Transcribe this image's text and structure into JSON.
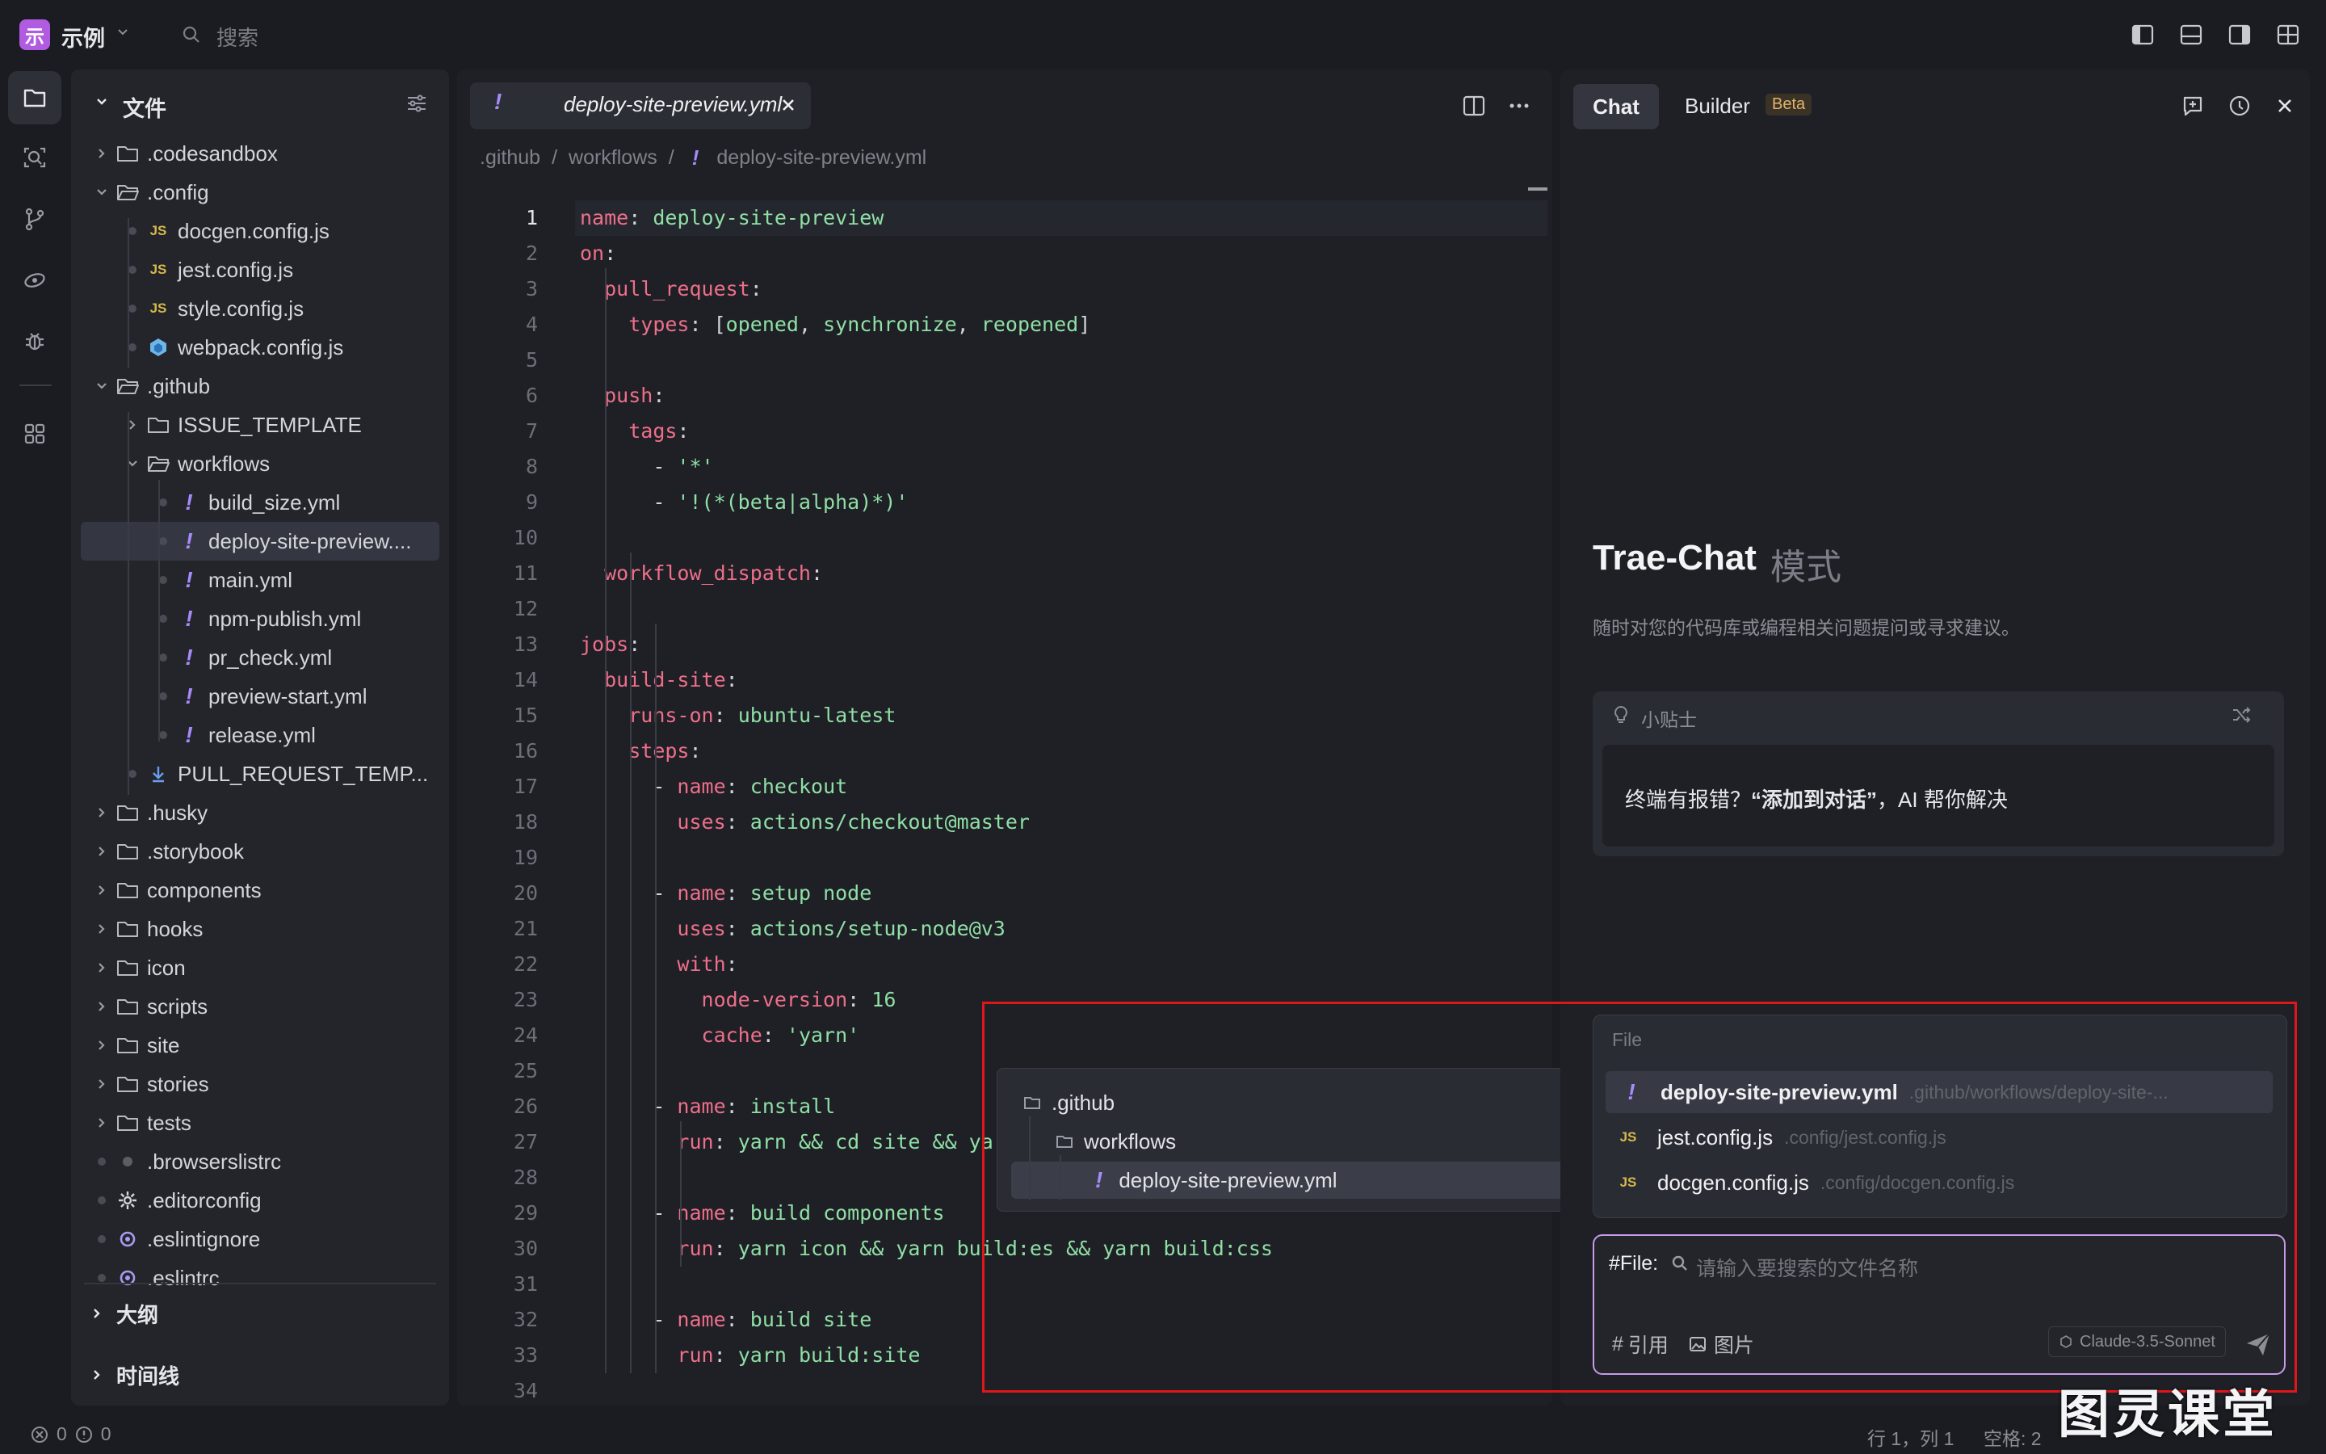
{
  "titlebar": {
    "logo_char": "示",
    "workspace": "示例",
    "search_placeholder": "搜索"
  },
  "explorer": {
    "title": "文件",
    "items": [
      {
        "label": ".codesandbox",
        "type": "folder",
        "expanded": false
      },
      {
        "label": ".config",
        "type": "folder",
        "expanded": true
      },
      {
        "label": "docgen.config.js",
        "type": "js"
      },
      {
        "label": "jest.config.js",
        "type": "js"
      },
      {
        "label": "style.config.js",
        "type": "js"
      },
      {
        "label": "webpack.config.js",
        "type": "webpack"
      },
      {
        "label": ".github",
        "type": "folder",
        "expanded": true
      },
      {
        "label": "ISSUE_TEMPLATE",
        "type": "folder",
        "expanded": false
      },
      {
        "label": "workflows",
        "type": "folder",
        "expanded": true
      },
      {
        "label": "build_size.yml",
        "type": "yml"
      },
      {
        "label": "deploy-site-preview....",
        "type": "yml",
        "selected": true
      },
      {
        "label": "main.yml",
        "type": "yml"
      },
      {
        "label": "npm-publish.yml",
        "type": "yml"
      },
      {
        "label": "pr_check.yml",
        "type": "yml"
      },
      {
        "label": "preview-start.yml",
        "type": "yml"
      },
      {
        "label": "release.yml",
        "type": "yml"
      },
      {
        "label": "PULL_REQUEST_TEMP...",
        "type": "md"
      },
      {
        "label": ".husky",
        "type": "folder",
        "expanded": false
      },
      {
        "label": ".storybook",
        "type": "folder",
        "expanded": false
      },
      {
        "label": "components",
        "type": "folder",
        "expanded": false
      },
      {
        "label": "hooks",
        "type": "folder",
        "expanded": false
      },
      {
        "label": "icon",
        "type": "folder",
        "expanded": false
      },
      {
        "label": "scripts",
        "type": "folder",
        "expanded": false
      },
      {
        "label": "site",
        "type": "folder",
        "expanded": false
      },
      {
        "label": "stories",
        "type": "folder",
        "expanded": false
      },
      {
        "label": "tests",
        "type": "folder",
        "expanded": false
      },
      {
        "label": ".browserslistrc",
        "type": "file"
      },
      {
        "label": ".editorconfig",
        "type": "gear"
      },
      {
        "label": ".eslintignore",
        "type": "circle"
      },
      {
        "label": ".eslintrc",
        "type": "circle"
      }
    ],
    "outline": "大纲",
    "timeline": "时间线"
  },
  "editor": {
    "tab_label": "deploy-site-preview.yml",
    "breadcrumb": [
      ".github",
      "workflows",
      "deploy-site-preview.yml"
    ],
    "lines": [
      "name: deploy-site-preview",
      "on:",
      "  pull_request:",
      "    types: [opened, synchronize, reopened]",
      "",
      "  push:",
      "    tags:",
      "      - '*'",
      "      - '!(*(beta|alpha)*)'",
      "",
      "  workflow_dispatch:",
      "",
      "jobs:",
      "  build-site:",
      "    runs-on: ubuntu-latest",
      "    steps:",
      "      - name: checkout",
      "        uses: actions/checkout@master",
      "",
      "      - name: setup node",
      "        uses: actions/setup-node@v3",
      "        with:",
      "          node-version: 16",
      "          cache: 'yarn'",
      "",
      "      - name: install",
      "        run: yarn && cd site && yarn",
      "",
      "      - name: build components",
      "        run: yarn icon && yarn build:es && yarn build:css",
      "",
      "      - name: build site",
      "        run: yarn build:site",
      ""
    ],
    "current_line": 1,
    "popup": [
      ".github",
      "workflows",
      "deploy-site-preview.yml"
    ]
  },
  "chat": {
    "tab_chat": "Chat",
    "tab_builder": "Builder",
    "beta": "Beta",
    "heading": "Trae-Chat",
    "heading_suffix": "模式",
    "description": "随时对您的代码库或编程相关问题提问或寻求建议。",
    "tips_title": "小贴士",
    "tips_text_1": "终端有报错？",
    "tips_text_bold": "“添加到对话”",
    "tips_text_2": "，AI 帮你解决",
    "file_header": "File",
    "files": [
      {
        "name": "deploy-site-preview.yml",
        "path": ".github/workflows/deploy-site-...",
        "type": "yml",
        "selected": true
      },
      {
        "name": "jest.config.js",
        "path": ".config/jest.config.js",
        "type": "js"
      },
      {
        "name": "docgen.config.js",
        "path": ".config/docgen.config.js",
        "type": "js"
      }
    ],
    "input_prefix": "#File:",
    "input_placeholder": "请输入要搜索的文件名称",
    "ref_label": "引用",
    "image_label": "图片",
    "model": "Claude-3.5-Sonnet"
  },
  "status": {
    "errors": "0",
    "warnings": "0",
    "position": "行 1，列 1",
    "spaces": "空格: 2"
  },
  "watermark": "图灵课堂"
}
